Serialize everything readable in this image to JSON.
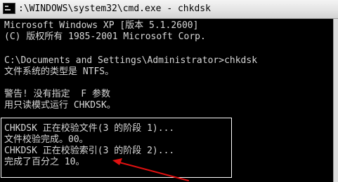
{
  "window": {
    "title": ":\\WINDOWS\\system32\\cmd.exe - chkdsk"
  },
  "console": {
    "lines": [
      "Microsoft Windows XP [版本 5.1.2600]",
      "(C) 版权所有 1985-2001 Microsoft Corp.",
      "",
      "C:\\Documents and Settings\\Administrator>chkdsk",
      "文件系统的类型是 NTFS。",
      "",
      "警告! 没有指定  F 参数",
      "用只读模式运行 CHKDSK。",
      "",
      "CHKDSK 正在校验文件(3 的阶段 1)...",
      "文件校验完成。00。",
      "CHKDSK 正在校验索引(3 的阶段 2)...",
      "完成了百分之 10。"
    ]
  },
  "colors": {
    "console_bg": "#000000",
    "console_text": "#d8d8d8",
    "annotation": "#e01010",
    "highlight_border": "#ffffff"
  },
  "icons": {
    "window_icon": "cmd-console-icon",
    "annotation": "red-arrow-icon"
  }
}
